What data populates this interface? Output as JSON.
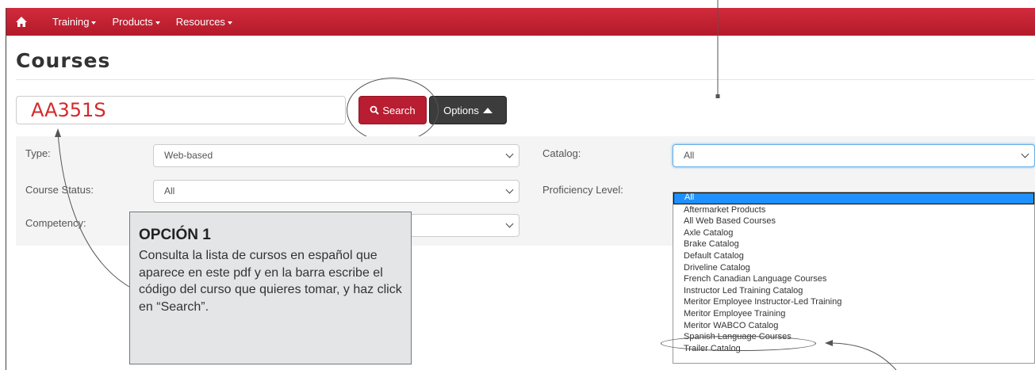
{
  "nav": {
    "items": [
      {
        "label": "Training"
      },
      {
        "label": "Products"
      },
      {
        "label": "Resources"
      }
    ]
  },
  "page": {
    "title": "Courses"
  },
  "search": {
    "value": "AA351S",
    "button_label": "Search",
    "options_label": "Options"
  },
  "filters": {
    "type_label": "Type:",
    "type_value": "Web-based",
    "status_label": "Course Status:",
    "status_value": "All",
    "competency_label": "Competency:",
    "catalog_label": "Catalog:",
    "catalog_value": "All",
    "proficiency_label": "Proficiency Level:"
  },
  "catalog_options": [
    "All",
    "Aftermarket Products",
    "All Web Based Courses",
    "Axle Catalog",
    "Brake Catalog",
    "Default Catalog",
    "Driveline Catalog",
    "French Canadian Language Courses",
    "Instructor Led Training Catalog",
    "Meritor Employee Instructor-Led Training",
    "Meritor Employee Training",
    "Meritor WABCO Catalog",
    "Spanish Language Courses",
    "Trailer Catalog"
  ],
  "callout": {
    "title": "OPCIÓN 1",
    "body": "Consulta la lista de cursos en español que aparece en este pdf y en la barra escribe el código del curso que quieres tomar, y haz click en “Search”."
  },
  "colors": {
    "nav_red": "#c8202f",
    "search_red": "#b81d31",
    "selected_blue": "#1e90ff"
  }
}
